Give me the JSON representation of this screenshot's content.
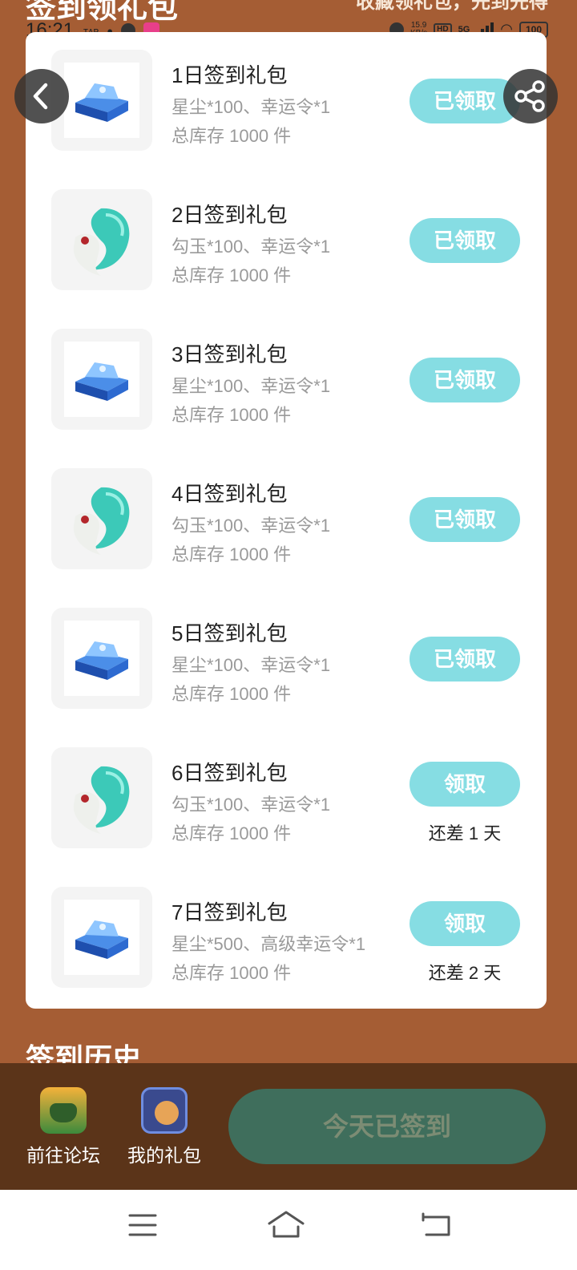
{
  "page_header": {
    "title_peek": "签到领礼包",
    "right_peek": "收藏领礼包，先到先得"
  },
  "status_bar": {
    "time": "16:21",
    "speed_value": "15.9",
    "speed_unit": "KB/s",
    "hd": "HD",
    "network": "5G",
    "battery": "100"
  },
  "gifts": [
    {
      "title": "1日签到礼包",
      "items": "星尘*100、幸运令*1",
      "stock": "总库存 1000 件",
      "icon": "stardust-icon",
      "button": "已领取",
      "remain": ""
    },
    {
      "title": "2日签到礼包",
      "items": "勾玉*100、幸运令*1",
      "stock": "总库存 1000 件",
      "icon": "magatama-icon",
      "button": "已领取",
      "remain": ""
    },
    {
      "title": "3日签到礼包",
      "items": "星尘*100、幸运令*1",
      "stock": "总库存 1000 件",
      "icon": "stardust-icon",
      "button": "已领取",
      "remain": ""
    },
    {
      "title": "4日签到礼包",
      "items": "勾玉*100、幸运令*1",
      "stock": "总库存 1000 件",
      "icon": "magatama-icon",
      "button": "已领取",
      "remain": ""
    },
    {
      "title": "5日签到礼包",
      "items": "星尘*100、幸运令*1",
      "stock": "总库存 1000 件",
      "icon": "stardust-icon",
      "button": "已领取",
      "remain": ""
    },
    {
      "title": "6日签到礼包",
      "items": "勾玉*100、幸运令*1",
      "stock": "总库存 1000 件",
      "icon": "magatama-icon",
      "button": "领取",
      "remain": "还差 1 天"
    },
    {
      "title": "7日签到礼包",
      "items": "星尘*500、高级幸运令*1",
      "stock": "总库存 1000 件",
      "icon": "stardust-icon",
      "button": "领取",
      "remain": "还差 2 天"
    }
  ],
  "history_title": "签到历史",
  "bottom_bar": {
    "forum_label": "前往论坛",
    "my_gifts_label": "我的礼包",
    "signed_button": "今天已签到"
  },
  "colors": {
    "background": "#a55d34",
    "claim_button": "#86dde3",
    "bottom_bar": "#5b3419",
    "signed_button": "#3f6e5c"
  }
}
